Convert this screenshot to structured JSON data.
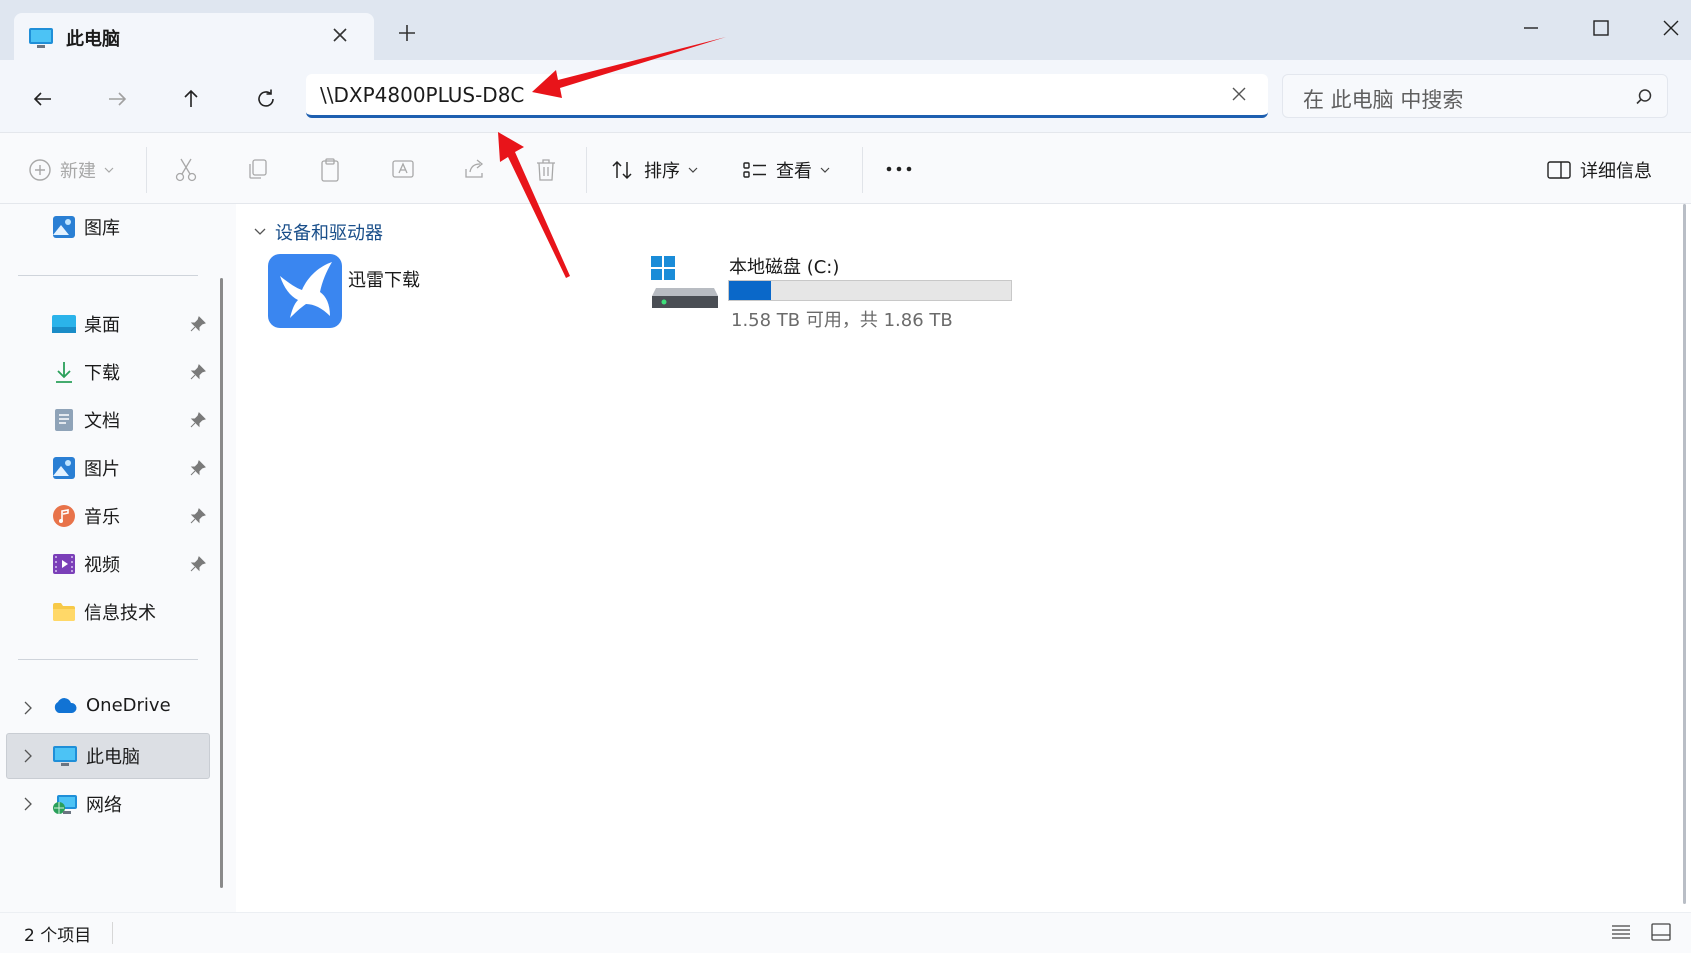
{
  "window": {
    "tab_title": "此电脑",
    "new_tab": "+"
  },
  "address": {
    "path": "\\\\DXP4800PLUS-D8C",
    "search_placeholder": "在 此电脑 中搜索"
  },
  "toolbar": {
    "new_label": "新建",
    "sort_label": "排序",
    "view_label": "查看",
    "details_label": "详细信息"
  },
  "sidebar": {
    "gallery": "图库",
    "quick": [
      {
        "label": "桌面",
        "icon": "desktop-icon"
      },
      {
        "label": "下载",
        "icon": "download-icon"
      },
      {
        "label": "文档",
        "icon": "document-icon"
      },
      {
        "label": "图片",
        "icon": "pictures-icon"
      },
      {
        "label": "音乐",
        "icon": "music-icon"
      },
      {
        "label": "视频",
        "icon": "video-icon"
      },
      {
        "label": "信息技术",
        "icon": "folder-icon"
      }
    ],
    "tree": [
      {
        "label": "OneDrive",
        "icon": "onedrive-icon"
      },
      {
        "label": "此电脑",
        "icon": "computer-icon",
        "selected": true
      },
      {
        "label": "网络",
        "icon": "network-icon"
      }
    ]
  },
  "content": {
    "group_title": "设备和驱动器",
    "items": [
      {
        "label": "迅雷下载",
        "icon": "xunlei-icon"
      },
      {
        "label": "本地磁盘 (C:)",
        "icon": "windows-drive-icon",
        "used_fraction": 0.15,
        "space_text": "1.58 TB 可用，共 1.86 TB"
      }
    ]
  },
  "status": {
    "count": "2 个项目"
  },
  "colors": {
    "accent": "#1d5fb0",
    "drive_bar": "#0a68c9",
    "annotation_arrow": "#e8141a"
  }
}
